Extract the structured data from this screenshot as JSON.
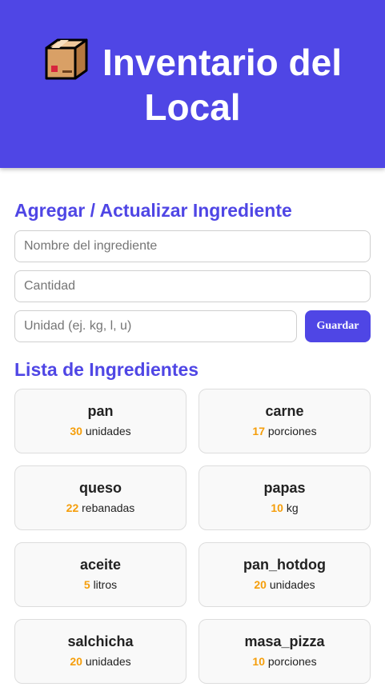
{
  "header": {
    "icon": "package-box-icon",
    "title": "Inventario del Local"
  },
  "form": {
    "title": "Agregar / Actualizar Ingrediente",
    "name_placeholder": "Nombre del ingrediente",
    "quantity_placeholder": "Cantidad",
    "unit_placeholder": "Unidad (ej. kg, l, u)",
    "save_label": "Guardar"
  },
  "list": {
    "title": "Lista de Ingredientes",
    "items": [
      {
        "name": "pan",
        "qty": "30",
        "unit": "unidades"
      },
      {
        "name": "carne",
        "qty": "17",
        "unit": "porciones"
      },
      {
        "name": "queso",
        "qty": "22",
        "unit": "rebanadas"
      },
      {
        "name": "papas",
        "qty": "10",
        "unit": "kg"
      },
      {
        "name": "aceite",
        "qty": "5",
        "unit": "litros"
      },
      {
        "name": "pan_hotdog",
        "qty": "20",
        "unit": "unidades"
      },
      {
        "name": "salchicha",
        "qty": "20",
        "unit": "unidades"
      },
      {
        "name": "masa_pizza",
        "qty": "10",
        "unit": "porciones"
      }
    ]
  },
  "colors": {
    "primary": "#4f46e5",
    "quantity": "#f59e0b"
  }
}
